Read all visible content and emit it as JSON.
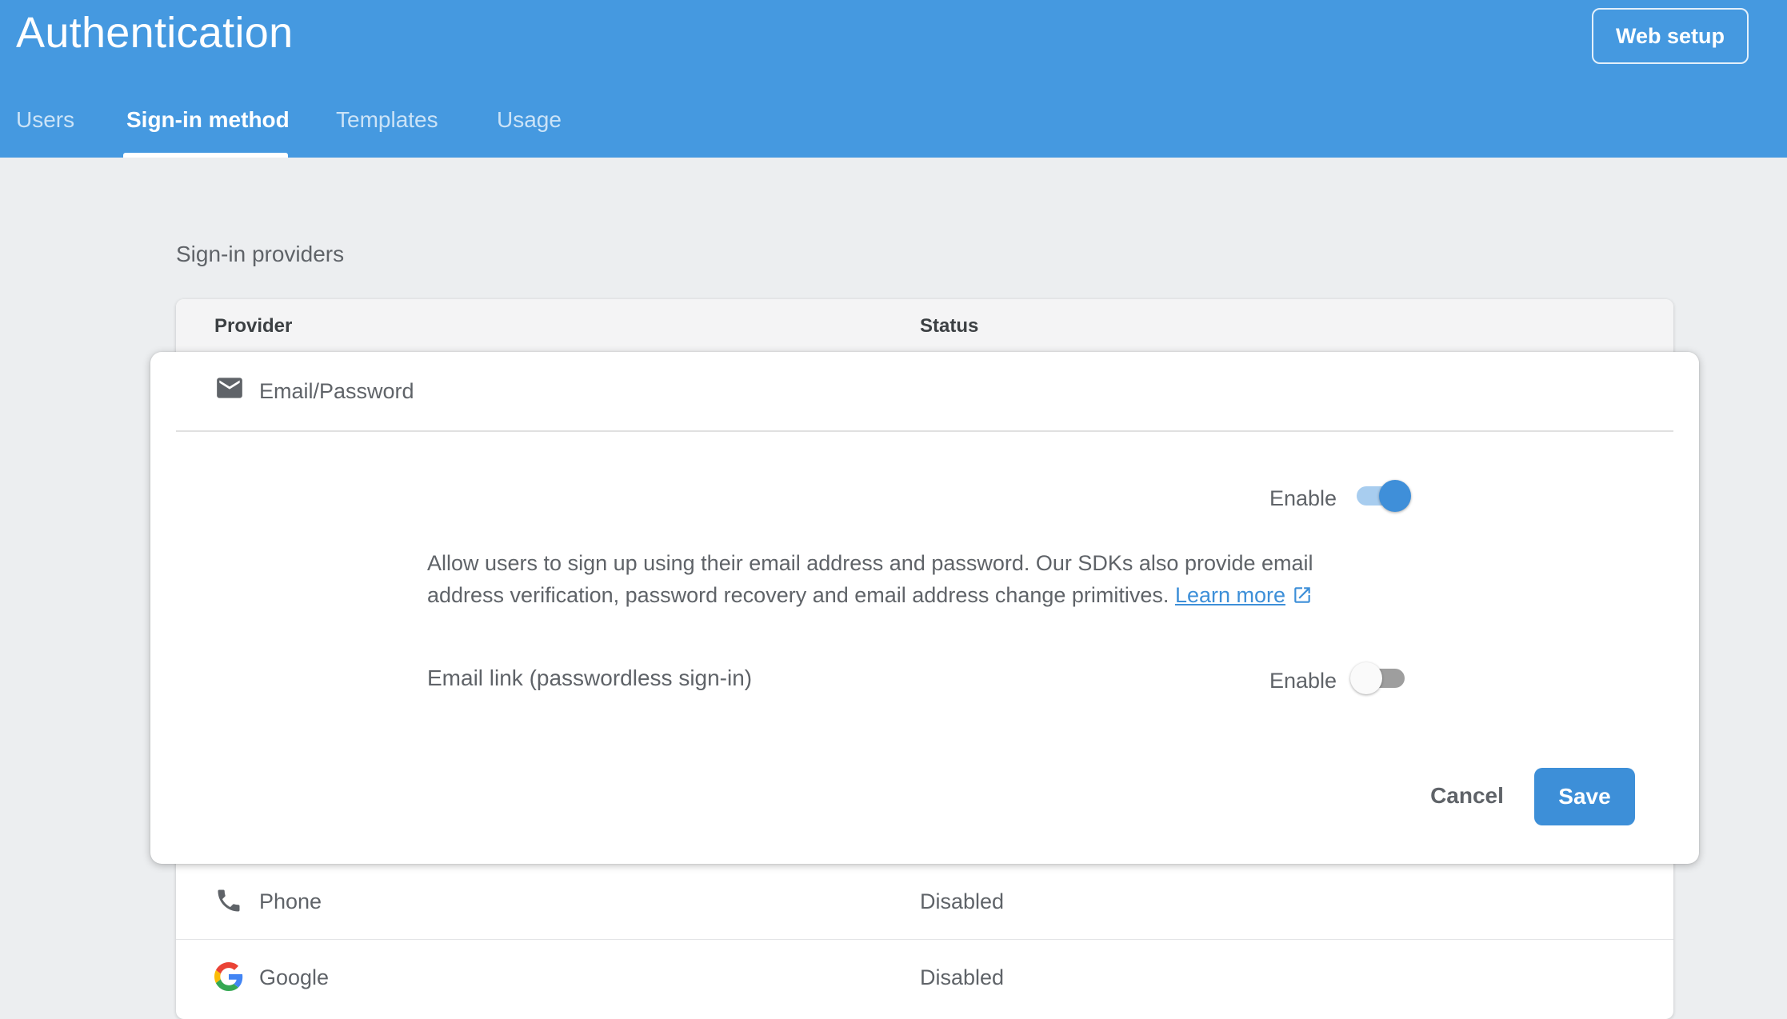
{
  "header": {
    "title": "Authentication",
    "web_setup_label": "Web setup",
    "tabs": [
      {
        "label": "Users",
        "active": false
      },
      {
        "label": "Sign-in method",
        "active": true
      },
      {
        "label": "Templates",
        "active": false
      },
      {
        "label": "Usage",
        "active": false
      }
    ]
  },
  "section_title": "Sign-in providers",
  "table": {
    "columns": [
      "Provider",
      "Status"
    ],
    "rows": [
      {
        "icon": "phone-icon",
        "name": "Phone",
        "status": "Disabled"
      },
      {
        "icon": "google-icon",
        "name": "Google",
        "status": "Disabled"
      }
    ]
  },
  "editor": {
    "provider": {
      "icon": "email-icon",
      "name": "Email/Password"
    },
    "enable_label": "Enable",
    "enabled": true,
    "description": "Allow users to sign up using their email address and password. Our SDKs also provide email address verification, password recovery and email address change primitives.",
    "learn_more": "Learn more",
    "email_link": {
      "label": "Email link (passwordless sign-in)",
      "enable_label": "Enable",
      "enabled": false
    },
    "cancel_label": "Cancel",
    "save_label": "Save"
  },
  "colors": {
    "header": "#4599e0",
    "accent": "#3d8fd8",
    "background": "#eceef0"
  }
}
